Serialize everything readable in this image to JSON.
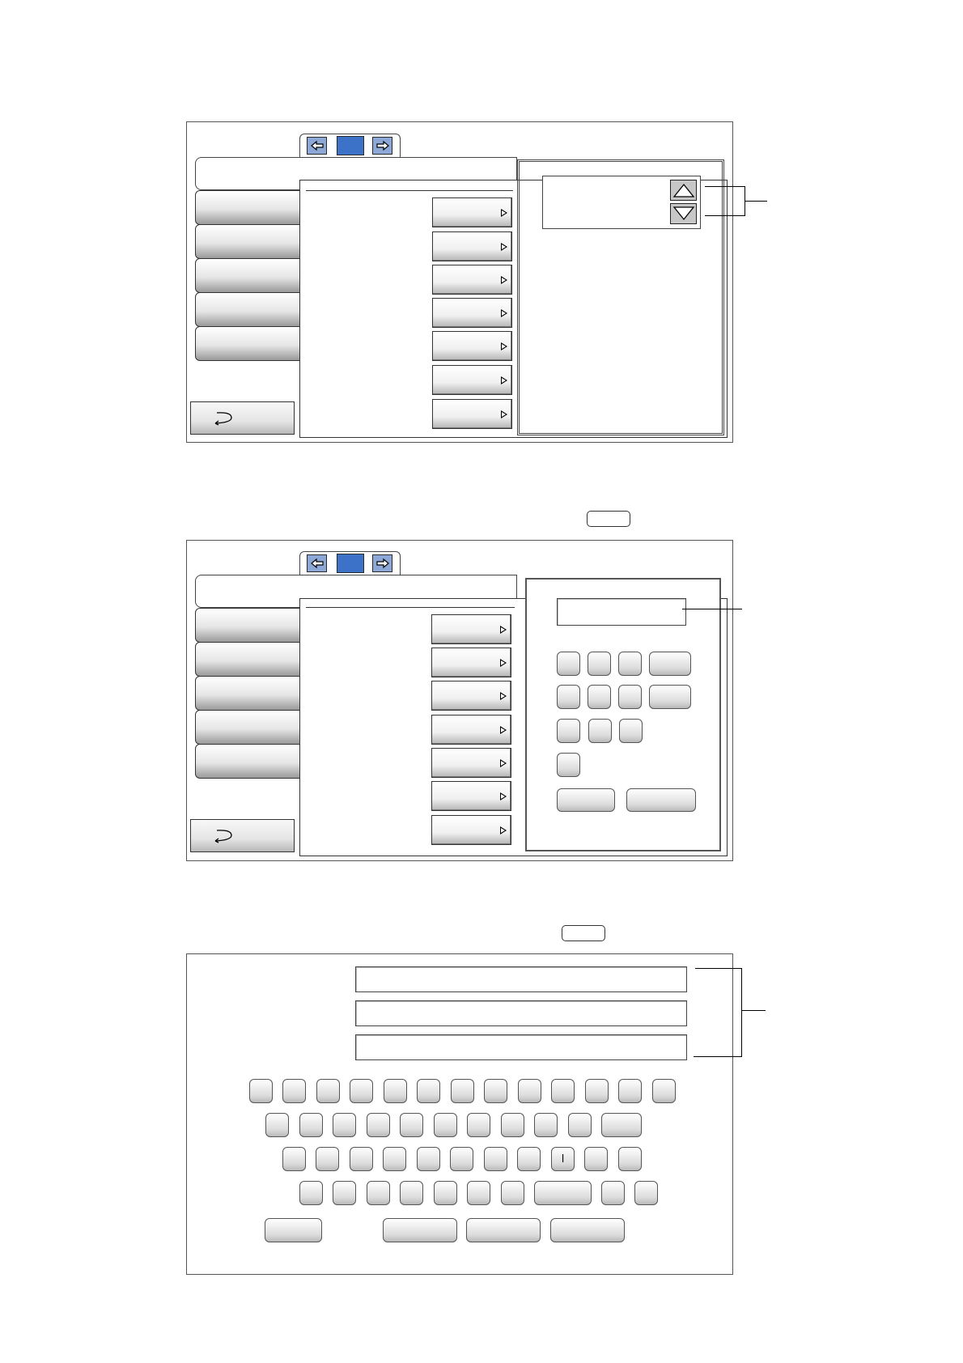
{
  "screen1": {
    "tabs": {
      "prev_icon": "arrow-left-icon",
      "next_icon": "arrow-right-icon"
    },
    "side_menu_count": 5,
    "option_button_count": 7,
    "panel": {
      "up_icon": "triangle-up-icon",
      "down_icon": "triangle-down-icon"
    },
    "back_icon": "return-arrow-icon"
  },
  "screen2": {
    "tabs": {
      "prev_icon": "arrow-left-icon",
      "next_icon": "arrow-right-icon"
    },
    "side_menu_count": 5,
    "option_button_count": 7,
    "numpad": {
      "rows": [
        4,
        4,
        3,
        1
      ],
      "bottom_buttons": 2
    },
    "back_icon": "return-arrow-icon"
  },
  "screen3": {
    "text_fields": 3,
    "keyboard": {
      "row_counts": [
        13,
        11,
        11,
        10
      ],
      "row3_key9_label": "l",
      "bottom_buttons": 4
    }
  },
  "colors": {
    "nav_button": "#8da7d6",
    "nav_center": "#3d72c9",
    "arrow_button": "#c7c7c7"
  }
}
